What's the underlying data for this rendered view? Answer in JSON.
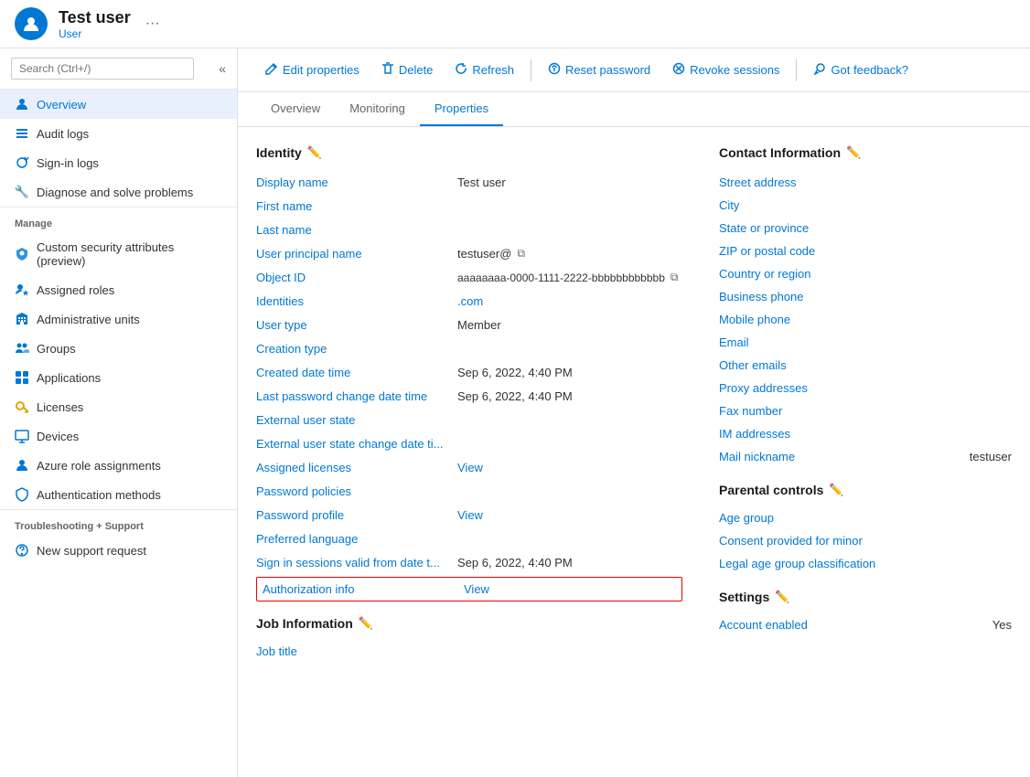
{
  "header": {
    "user_name": "Test user",
    "user_type": "User",
    "more_label": "···"
  },
  "sidebar": {
    "search_placeholder": "Search (Ctrl+/)",
    "items": [
      {
        "id": "overview",
        "label": "Overview",
        "icon": "person",
        "active": true
      },
      {
        "id": "audit-logs",
        "label": "Audit logs",
        "icon": "list"
      },
      {
        "id": "sign-in-logs",
        "label": "Sign-in logs",
        "icon": "refresh-circle"
      },
      {
        "id": "diagnose",
        "label": "Diagnose and solve problems",
        "icon": "wrench"
      }
    ],
    "manage_section": "Manage",
    "manage_items": [
      {
        "id": "custom-security",
        "label": "Custom security attributes (preview)",
        "icon": "shield-person"
      },
      {
        "id": "assigned-roles",
        "label": "Assigned roles",
        "icon": "person-star"
      },
      {
        "id": "admin-units",
        "label": "Administrative units",
        "icon": "building"
      },
      {
        "id": "groups",
        "label": "Groups",
        "icon": "people"
      },
      {
        "id": "applications",
        "label": "Applications",
        "icon": "app-grid"
      },
      {
        "id": "licenses",
        "label": "Licenses",
        "icon": "key"
      },
      {
        "id": "devices",
        "label": "Devices",
        "icon": "monitor"
      },
      {
        "id": "azure-roles",
        "label": "Azure role assignments",
        "icon": "person-badge"
      },
      {
        "id": "auth-methods",
        "label": "Authentication methods",
        "icon": "shield"
      }
    ],
    "troubleshoot_section": "Troubleshooting + Support",
    "troubleshoot_items": [
      {
        "id": "new-support",
        "label": "New support request",
        "icon": "question-circle"
      }
    ]
  },
  "toolbar": {
    "edit_label": "Edit properties",
    "delete_label": "Delete",
    "refresh_label": "Refresh",
    "reset_password_label": "Reset password",
    "revoke_sessions_label": "Revoke sessions",
    "feedback_label": "Got feedback?"
  },
  "tabs": [
    {
      "id": "overview",
      "label": "Overview",
      "active": false
    },
    {
      "id": "monitoring",
      "label": "Monitoring",
      "active": false
    },
    {
      "id": "properties",
      "label": "Properties",
      "active": true
    }
  ],
  "identity_section": {
    "title": "Identity",
    "properties": [
      {
        "label": "Display name",
        "value": "Test user",
        "type": "text"
      },
      {
        "label": "First name",
        "value": "",
        "type": "text"
      },
      {
        "label": "Last name",
        "value": "",
        "type": "text"
      },
      {
        "label": "User principal name",
        "value": "testuser@",
        "type": "copy"
      },
      {
        "label": "Object ID",
        "value": "aaaaaaaa-0000-1111-2222-bbbbbbbbbbbb",
        "type": "copy"
      },
      {
        "label": "Identities",
        "value": ".com",
        "type": "link-value"
      },
      {
        "label": "User type",
        "value": "Member",
        "type": "text"
      },
      {
        "label": "Creation type",
        "value": "",
        "type": "text"
      },
      {
        "label": "Created date time",
        "value": "Sep 6, 2022, 4:40 PM",
        "type": "text"
      },
      {
        "label": "Last password change date time",
        "value": "Sep 6, 2022, 4:40 PM",
        "type": "text"
      },
      {
        "label": "External user state",
        "value": "",
        "type": "text"
      },
      {
        "label": "External user state change date ti...",
        "value": "",
        "type": "text"
      },
      {
        "label": "Assigned licenses",
        "value": "View",
        "type": "link"
      },
      {
        "label": "Password policies",
        "value": "",
        "type": "text"
      },
      {
        "label": "Password profile",
        "value": "View",
        "type": "link"
      },
      {
        "label": "Preferred language",
        "value": "",
        "type": "text"
      },
      {
        "label": "Sign in sessions valid from date t...",
        "value": "Sep 6, 2022, 4:40 PM",
        "type": "text"
      }
    ],
    "authorization_row": {
      "label": "Authorization info",
      "value": "View"
    }
  },
  "job_section": {
    "title": "Job Information",
    "properties": [
      {
        "label": "Job title",
        "value": "",
        "type": "text"
      }
    ]
  },
  "contact_section": {
    "title": "Contact Information",
    "properties": [
      {
        "label": "Street address",
        "value": ""
      },
      {
        "label": "City",
        "value": ""
      },
      {
        "label": "State or province",
        "value": ""
      },
      {
        "label": "ZIP or postal code",
        "value": ""
      },
      {
        "label": "Country or region",
        "value": ""
      },
      {
        "label": "Business phone",
        "value": ""
      },
      {
        "label": "Mobile phone",
        "value": ""
      },
      {
        "label": "Email",
        "value": ""
      },
      {
        "label": "Other emails",
        "value": ""
      },
      {
        "label": "Proxy addresses",
        "value": ""
      },
      {
        "label": "Fax number",
        "value": ""
      },
      {
        "label": "IM addresses",
        "value": ""
      },
      {
        "label": "Mail nickname",
        "value": "testuser"
      }
    ]
  },
  "parental_section": {
    "title": "Parental controls",
    "properties": [
      {
        "label": "Age group",
        "value": ""
      },
      {
        "label": "Consent provided for minor",
        "value": ""
      },
      {
        "label": "Legal age group classification",
        "value": ""
      }
    ]
  },
  "settings_section": {
    "title": "Settings",
    "properties": [
      {
        "label": "Account enabled",
        "value": "Yes"
      }
    ]
  }
}
